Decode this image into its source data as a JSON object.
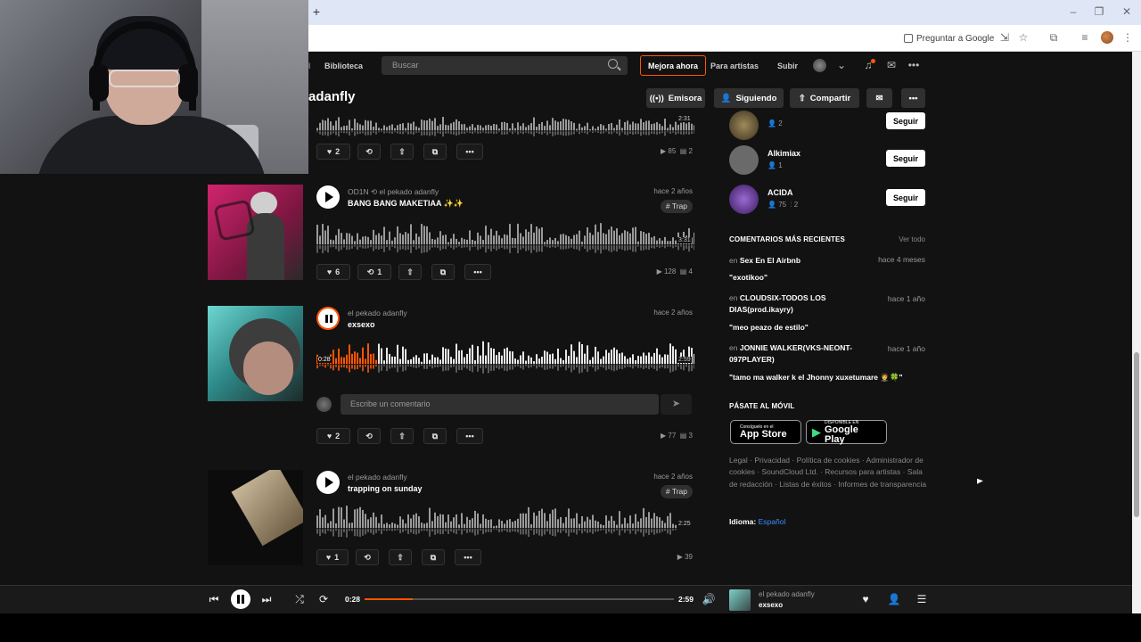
{
  "browser": {
    "new_tab": "+",
    "ask_google": "Preguntar a Google"
  },
  "header": {
    "library": "Biblioteca",
    "search_placeholder": "Buscar",
    "upgrade": "Mejora ahora",
    "for_artists": "Para artistas",
    "upload": "Subir"
  },
  "profile": {
    "name": "adanfly",
    "station": "Emisora",
    "following": "Siguiendo",
    "share": "Compartir"
  },
  "tracks": [
    {
      "likes": "2",
      "plays": "85",
      "comments": "2",
      "duration": "2:31"
    },
    {
      "user": "OD1N",
      "repost_user": "el pekado adanfly",
      "title": "BANG BANG MAKETIAA",
      "title_emoji": "✨✨",
      "date": "hace 2 años",
      "tag": "# Trap",
      "duration": "3:31",
      "likes": "6",
      "reposts": "1",
      "plays": "128",
      "comments": "4"
    },
    {
      "user": "el pekado adanfly",
      "title": "exsexo",
      "date": "hace 2 años",
      "position": "0:28",
      "duration": "2:59",
      "comment_placeholder": "Escribe un comentario",
      "likes": "2",
      "plays": "77",
      "comments": "3"
    },
    {
      "user": "el pekado adanfly",
      "title": "trapping on sunday",
      "date": "hace 2 años",
      "tag": "# Trap",
      "duration": "2:25",
      "likes": "1",
      "plays": "39"
    }
  ],
  "sidebar": {
    "following": [
      {
        "name": "",
        "followers": "2",
        "color": "#7a6a3e"
      },
      {
        "name": "Alkimiax",
        "followers": "1",
        "color": "#6a6a6a"
      },
      {
        "name": "ACIDA",
        "followers": "75",
        "tracks": "2",
        "color": "#6b3fa0"
      }
    ],
    "follow_label": "Seguir",
    "recent_comments_title": "COMENTARIOS MÁS RECIENTES",
    "view_all": "Ver todo",
    "comments": [
      {
        "in": "en",
        "track": "Sex En El Airbnb",
        "when": "hace 4 meses",
        "text": "\"exotikoo\""
      },
      {
        "in": "en",
        "track": "CLOUDSIX-TODOS LOS DIAS(prod.ikayry)",
        "when": "hace 1 año",
        "text": "\"meo peazo de estilo\""
      },
      {
        "in": "en",
        "track": "JONNIE WALKER(VKS-NEONT-097PLAYER)",
        "when": "hace 1 año",
        "text": "\"tamo ma walker k el Jhonny xuxetumare 🤵🍀\""
      }
    ],
    "mobile_title": "PÁSATE AL MÓVIL",
    "appstore_small": "Consíguelo en el",
    "appstore_big": "App Store",
    "googleplay_small": "DISPONIBLE EN",
    "googleplay_big": "Google Play",
    "footer_links": "Legal · Privacidad · Política de cookies · Administrador de cookies · SoundCloud Ltd. · Recursos para artistas · Sala de redacción · Listas de éxitos · Informes de transparencia",
    "language_label": "Idioma:",
    "language_value": "Español"
  },
  "player": {
    "position": "0:28",
    "duration": "2:59",
    "progress": 0.156,
    "user": "el pekado adanfly",
    "title": "exsexo"
  },
  "colors": {
    "accent": "#ff5500",
    "background": "#121212"
  }
}
